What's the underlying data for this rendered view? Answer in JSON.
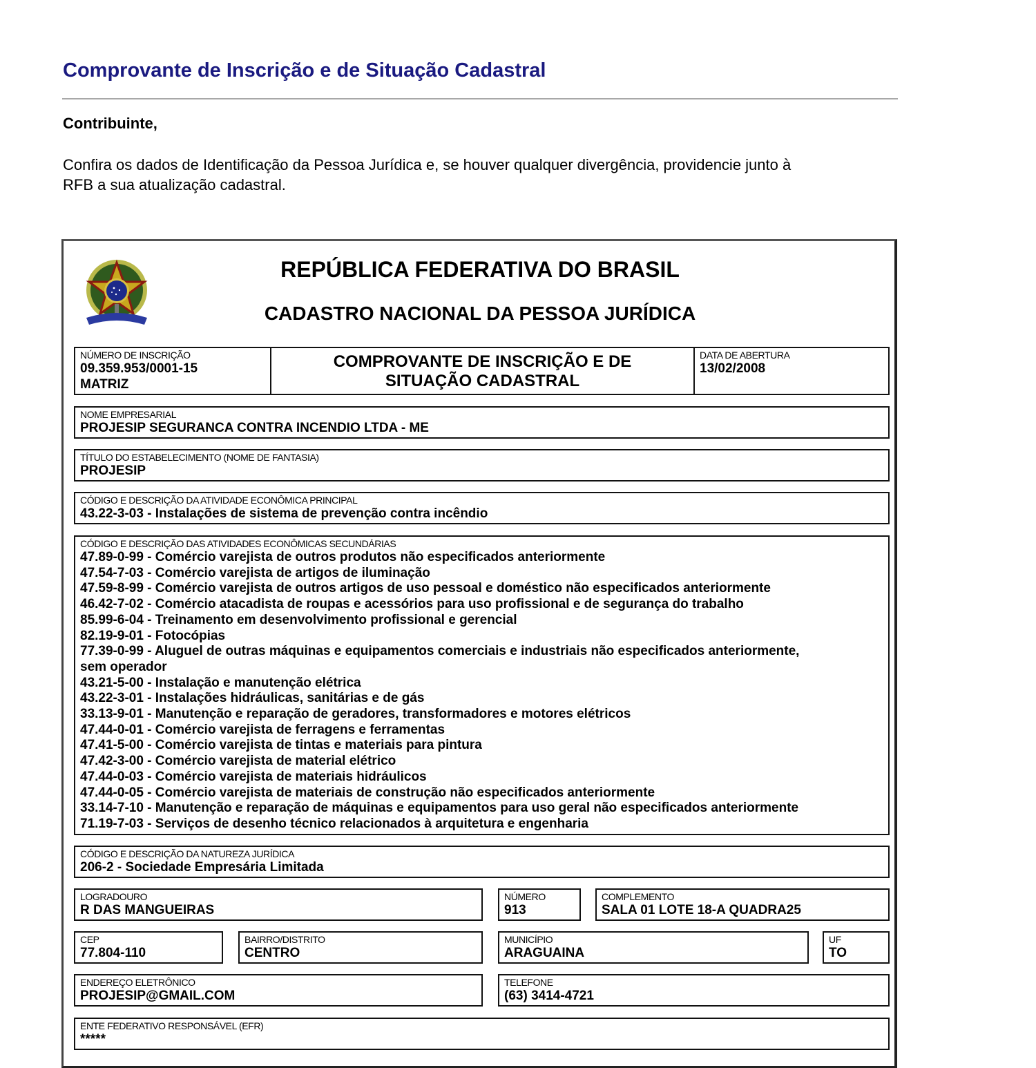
{
  "page": {
    "title": "Comprovante de Inscrição e de Situação Cadastral",
    "greeting": "Contribuinte,",
    "intro_line1": "Confira os dados de Identificação da Pessoa Jurídica e, se houver qualquer divergência, providencie junto à",
    "intro_line2": "RFB a sua atualização cadastral.",
    "accent_color": "#1a1a80"
  },
  "header": {
    "emblem_icon": "brazil-coat-of-arms",
    "line1": "REPÚBLICA FEDERATIVA DO BRASIL",
    "line2": "CADASTRO NACIONAL DA PESSOA JURÍDICA"
  },
  "registration": {
    "label": "NÚMERO DE INSCRIÇÃO",
    "number": "09.359.953/0001-15",
    "type": "MATRIZ",
    "doc_title_line1": "COMPROVANTE DE INSCRIÇÃO E DE",
    "doc_title_line2": "SITUAÇÃO CADASTRAL",
    "opening_label": "DATA DE ABERTURA",
    "opening_date": "13/02/2008"
  },
  "company": {
    "name_label": "NOME EMPRESARIAL",
    "name": "PROJESIP SEGURANCA CONTRA INCENDIO LTDA - ME",
    "trade_label": "TÍTULO DO ESTABELECIMENTO (NOME DE FANTASIA)",
    "trade_name": "PROJESIP"
  },
  "main_activity": {
    "label": "CÓDIGO E DESCRIÇÃO DA ATIVIDADE ECONÔMICA PRINCIPAL",
    "value": "43.22-3-03 - Instalações de sistema de prevenção contra incêndio"
  },
  "secondary_activities": {
    "label": "CÓDIGO E DESCRIÇÃO DAS ATIVIDADES ECONÔMICAS SECUNDÁRIAS",
    "items": [
      "47.89-0-99 - Comércio varejista de outros produtos não especificados anteriormente",
      "47.54-7-03 - Comércio varejista de artigos de iluminação",
      "47.59-8-99 - Comércio varejista de outros artigos de uso pessoal e doméstico não especificados anteriormente",
      "46.42-7-02 - Comércio atacadista de roupas e acessórios para uso profissional e de segurança do trabalho",
      "85.99-6-04 - Treinamento em desenvolvimento profissional e gerencial",
      "82.19-9-01 - Fotocópias",
      "77.39-0-99 - Aluguel de outras máquinas e equipamentos comerciais e industriais não especificados anteriormente,",
      "sem operador",
      "43.21-5-00 - Instalação e manutenção elétrica",
      "43.22-3-01 - Instalações hidráulicas, sanitárias e de gás",
      "33.13-9-01 - Manutenção e reparação de geradores, transformadores e motores elétricos",
      "47.44-0-01 - Comércio varejista de ferragens e ferramentas",
      "47.41-5-00 - Comércio varejista de tintas e materiais para pintura",
      "47.42-3-00 - Comércio varejista de material elétrico",
      "47.44-0-03 - Comércio varejista de materiais hidráulicos",
      "47.44-0-05 - Comércio varejista de materiais de construção não especificados anteriormente",
      "33.14-7-10 - Manutenção e reparação de máquinas e equipamentos para uso geral não especificados anteriormente",
      "71.19-7-03 - Serviços de desenho técnico relacionados à arquitetura e engenharia"
    ]
  },
  "legal_nature": {
    "label": "CÓDIGO E DESCRIÇÃO DA NATUREZA JURÍDICA",
    "value": "206-2 - Sociedade Empresária Limitada"
  },
  "address": {
    "street_label": "LOGRADOURO",
    "street": "R DAS MANGUEIRAS",
    "number_label": "NÚMERO",
    "number": "913",
    "complement_label": "COMPLEMENTO",
    "complement": "SALA 01 LOTE 18-A QUADRA25",
    "cep_label": "CEP",
    "cep": "77.804-110",
    "district_label": "BAIRRO/DISTRITO",
    "district": "CENTRO",
    "city_label": "MUNICÍPIO",
    "city": "ARAGUAINA",
    "uf_label": "UF",
    "uf": "TO"
  },
  "contact": {
    "email_label": "ENDEREÇO ELETRÔNICO",
    "email": "PROJESIP@GMAIL.COM",
    "phone_label": "TELEFONE",
    "phone": "(63) 3414-4721"
  },
  "efr": {
    "label": "ENTE FEDERATIVO RESPONSÁVEL (EFR)",
    "value": "*****"
  }
}
